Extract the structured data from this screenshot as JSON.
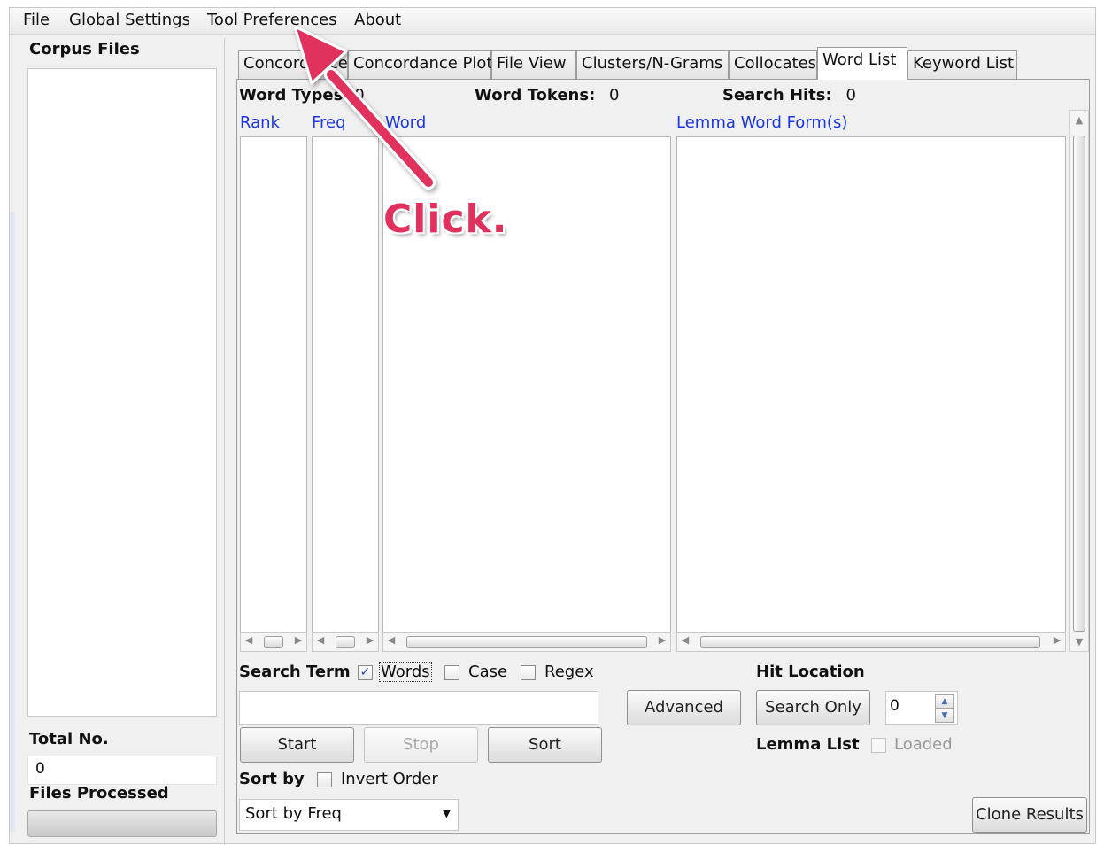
{
  "menu": {
    "file": "File",
    "global_settings": "Global Settings",
    "tool_preferences": "Tool Preferences",
    "about": "About"
  },
  "left_panel": {
    "corpus_files_label": "Corpus Files",
    "total_no_label": "Total No.",
    "total_no_value": "0",
    "files_processed_label": "Files Processed",
    "files_processed_progress": 0
  },
  "tabs": [
    {
      "label": "Concordance",
      "active": false
    },
    {
      "label": "Concordance Plot",
      "active": false
    },
    {
      "label": "File View",
      "active": false
    },
    {
      "label": "Clusters/N-Grams",
      "active": false
    },
    {
      "label": "Collocates",
      "active": false
    },
    {
      "label": "Word List",
      "active": true
    },
    {
      "label": "Keyword List",
      "active": false
    }
  ],
  "stats": {
    "word_types_label": "Word Types:",
    "word_types_value": "0",
    "word_tokens_label": "Word Tokens:",
    "word_tokens_value": "0",
    "search_hits_label": "Search Hits:",
    "search_hits_value": "0"
  },
  "columns": {
    "rank": "Rank",
    "freq": "Freq",
    "word": "Word",
    "lemma": "Lemma Word Form(s)"
  },
  "search": {
    "label": "Search Term",
    "words_label": "Words",
    "words_checked": true,
    "case_label": "Case",
    "case_checked": false,
    "regex_label": "Regex",
    "regex_checked": false,
    "input_value": "",
    "advanced_button": "Advanced"
  },
  "hit_location": {
    "label": "Hit Location",
    "search_only_button": "Search Only",
    "spinner_value": "0"
  },
  "actions": {
    "start": "Start",
    "stop": "Stop",
    "sort": "Sort"
  },
  "lemma_list": {
    "label": "Lemma List",
    "loaded_label": "Loaded",
    "loaded_checked": false
  },
  "sort_by": {
    "label": "Sort by",
    "invert_label": "Invert Order",
    "invert_checked": false,
    "selected": "Sort by Freq"
  },
  "clone_results": "Clone Results",
  "annotation": {
    "text": "Click.",
    "color": "#e0305d"
  }
}
